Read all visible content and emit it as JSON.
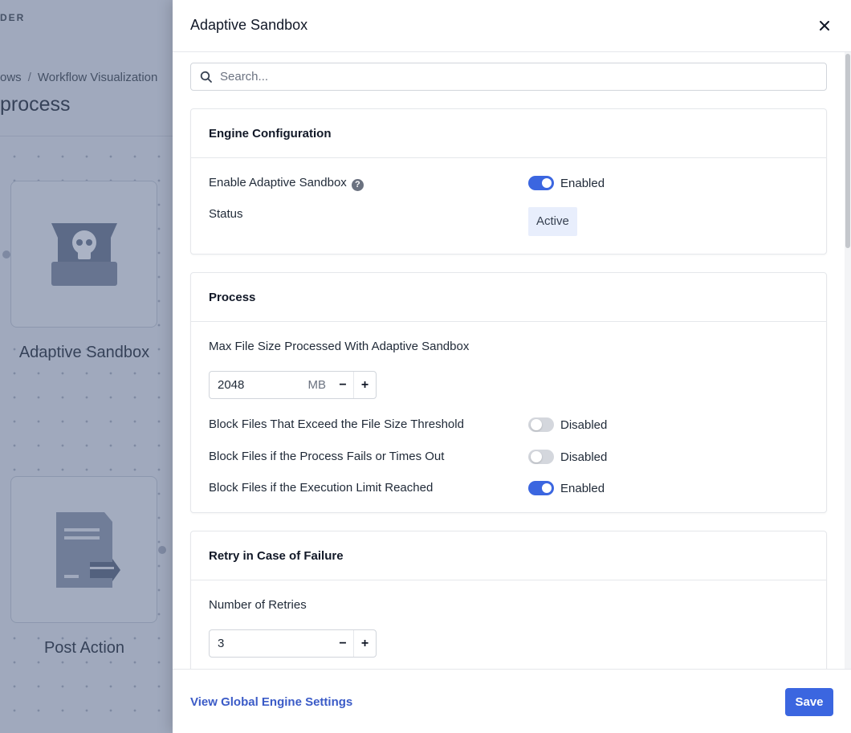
{
  "background": {
    "logo_fragment": "DER",
    "breadcrumb": {
      "parent": "ows",
      "separator": "/",
      "current": "Workflow Visualization"
    },
    "page_title_fragment": "process",
    "nodes": [
      {
        "label": "Adaptive Sandbox",
        "icon": "sandbox-skull-icon"
      },
      {
        "label": "Post Action",
        "icon": "document-export-icon"
      }
    ]
  },
  "drawer": {
    "title": "Adaptive Sandbox",
    "close_icon": "close-icon",
    "search": {
      "placeholder": "Search...",
      "value": ""
    },
    "sections": {
      "engine": {
        "title": "Engine Configuration",
        "enable_label": "Enable Adaptive Sandbox",
        "enable_state": "Enabled",
        "enable_on": true,
        "status_label": "Status",
        "status_value": "Active"
      },
      "process": {
        "title": "Process",
        "max_size_label": "Max File Size Processed With Adaptive Sandbox",
        "max_size_value": "2048",
        "max_size_unit": "MB",
        "block_threshold_label": "Block Files That Exceed the File Size Threshold",
        "block_threshold_state": "Disabled",
        "block_fail_label": "Block Files if the Process Fails or Times Out",
        "block_fail_state": "Disabled",
        "block_limit_label": "Block Files if the Execution Limit Reached",
        "block_limit_state": "Enabled"
      },
      "retry": {
        "title": "Retry in Case of Failure",
        "retries_label": "Number of Retries",
        "retries_value": "3"
      }
    },
    "stepper_minus": "−",
    "stepper_plus": "+",
    "footer": {
      "link_label": "View Global Engine Settings",
      "save_label": "Save"
    }
  },
  "colors": {
    "accent": "#3b66e0",
    "link": "#3b5bc7",
    "status_badge_bg": "#e8eefc"
  }
}
